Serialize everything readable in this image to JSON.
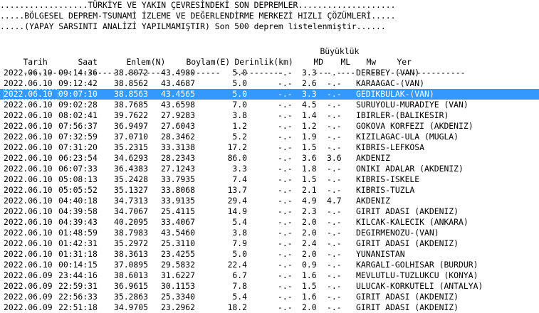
{
  "banner": [
    "..................TÜRKİYE VE YAKIN ÇEVRESİNDEKİ SON DEPREMLER....................",
    ".....BÖLGESEL DEPREM-TSUNAMİ İZLEME VE DEĞERLENDİRME MERKEZİ HIZLI ÇÖZÜMLERİ.....",
    ".....(YAPAY SARSINTI ANALİZİ YAPILMAMIŞTIR) Son 500 deprem listelenmiştir......"
  ],
  "columns": {
    "magnitude_group": "Büyüklük",
    "date": "Tarih",
    "time": "Saat",
    "lat": "Enlem(N)",
    "lon": "Boylam(E)",
    "depth": "Derinlik(km)",
    "md": "MD",
    "ml": "ML",
    "mw": "Mw",
    "place": "Yer"
  },
  "separators": {
    "date": "----------",
    "time": "--------",
    "lat": "--------",
    "lon": "-------",
    "depth": "----------",
    "md": "---",
    "ml": "---",
    "mw": "---",
    "place": "--------------"
  },
  "selected_index": 2,
  "rows": [
    {
      "date": "2022.06.10",
      "time": "09:14:36",
      "lat": "38.8072",
      "lon": "43.4980",
      "depth": "5.0",
      "md": "-.-",
      "ml": "3.3",
      "mw": "-.-",
      "place": "DEREBEY-(VAN)"
    },
    {
      "date": "2022.06.10",
      "time": "09:12:42",
      "lat": "38.8562",
      "lon": "43.4687",
      "depth": "5.0",
      "md": "-.-",
      "ml": "2.6",
      "mw": "-.-",
      "place": "KARAAGAC-(VAN)"
    },
    {
      "date": "2022.06.10",
      "time": "09:07:10",
      "lat": "38.8563",
      "lon": "43.4565",
      "depth": "5.0",
      "md": "-.-",
      "ml": "3.3",
      "mw": "-.-",
      "place": "GEDIKBULAK-(VAN)"
    },
    {
      "date": "2022.06.10",
      "time": "09:02:28",
      "lat": "38.7685",
      "lon": "43.6598",
      "depth": "7.0",
      "md": "-.-",
      "ml": "4.5",
      "mw": "-.-",
      "place": "SURUYOLU-MURADIYE (VAN)"
    },
    {
      "date": "2022.06.10",
      "time": "08:02:41",
      "lat": "39.7622",
      "lon": "27.9283",
      "depth": "3.8",
      "md": "-.-",
      "ml": "1.4",
      "mw": "-.-",
      "place": "IBIRLER-(BALIKESIR)"
    },
    {
      "date": "2022.06.10",
      "time": "07:56:37",
      "lat": "36.9497",
      "lon": "27.6043",
      "depth": "1.2",
      "md": "-.-",
      "ml": "1.2",
      "mw": "-.-",
      "place": "GOKOVA KORFEZI (AKDENIZ)"
    },
    {
      "date": "2022.06.10",
      "time": "07:32:59",
      "lat": "37.0710",
      "lon": "28.3462",
      "depth": "5.2",
      "md": "-.-",
      "ml": "1.9",
      "mw": "-.-",
      "place": "KIZILAGAC-ULA (MUGLA)"
    },
    {
      "date": "2022.06.10",
      "time": "07:31:20",
      "lat": "35.2315",
      "lon": "33.3138",
      "depth": "17.2",
      "md": "-.-",
      "ml": "1.5",
      "mw": "-.-",
      "place": "KIBRIS-LEFKOSA"
    },
    {
      "date": "2022.06.10",
      "time": "06:23:54",
      "lat": "34.6293",
      "lon": "28.2343",
      "depth": "86.0",
      "md": "-.-",
      "ml": "3.6",
      "mw": "3.6",
      "place": "AKDENIZ"
    },
    {
      "date": "2022.06.10",
      "time": "06:07:33",
      "lat": "36.4383",
      "lon": "27.1243",
      "depth": "3.3",
      "md": "-.-",
      "ml": "1.8",
      "mw": "-.-",
      "place": "ONIKI ADALAR (AKDENIZ)"
    },
    {
      "date": "2022.06.10",
      "time": "05:08:13",
      "lat": "35.2428",
      "lon": "33.7935",
      "depth": "7.4",
      "md": "-.-",
      "ml": "1.5",
      "mw": "-.-",
      "place": "KIBRIS-ISKELE"
    },
    {
      "date": "2022.06.10",
      "time": "05:05:52",
      "lat": "35.1327",
      "lon": "33.8068",
      "depth": "13.7",
      "md": "-.-",
      "ml": "2.1",
      "mw": "-.-",
      "place": "KIBRIS-TUZLA"
    },
    {
      "date": "2022.06.10",
      "time": "04:40:18",
      "lat": "34.7313",
      "lon": "33.9135",
      "depth": "29.4",
      "md": "-.-",
      "ml": "4.9",
      "mw": "4.7",
      "place": "AKDENIZ"
    },
    {
      "date": "2022.06.10",
      "time": "04:39:58",
      "lat": "34.7067",
      "lon": "25.4115",
      "depth": "14.9",
      "md": "-.-",
      "ml": "2.3",
      "mw": "-.-",
      "place": "GIRIT ADASI (AKDENIZ)"
    },
    {
      "date": "2022.06.10",
      "time": "04:39:43",
      "lat": "40.2095",
      "lon": "33.4067",
      "depth": "5.4",
      "md": "-.-",
      "ml": "2.0",
      "mw": "-.-",
      "place": "KILCAK-KALECIK (ANKARA)"
    },
    {
      "date": "2022.06.10",
      "time": "01:48:59",
      "lat": "38.7983",
      "lon": "43.5460",
      "depth": "3.8",
      "md": "-.-",
      "ml": "2.0",
      "mw": "-.-",
      "place": "DEGIRMENOZU-(VAN)"
    },
    {
      "date": "2022.06.10",
      "time": "01:42:31",
      "lat": "35.2972",
      "lon": "25.3110",
      "depth": "7.9",
      "md": "-.-",
      "ml": "2.4",
      "mw": "-.-",
      "place": "GIRIT ADASI (AKDENIZ)"
    },
    {
      "date": "2022.06.10",
      "time": "01:31:18",
      "lat": "38.3613",
      "lon": "23.4255",
      "depth": "5.0",
      "md": "-.-",
      "ml": "2.0",
      "mw": "-.-",
      "place": "YUNANISTAN"
    },
    {
      "date": "2022.06.10",
      "time": "00:14:15",
      "lat": "37.0895",
      "lon": "29.5832",
      "depth": "22.4",
      "md": "-.-",
      "ml": "0.9",
      "mw": "-.-",
      "place": "KARGALI-GOLHISAR (BURDUR)"
    },
    {
      "date": "2022.06.09",
      "time": "23:44:16",
      "lat": "38.6013",
      "lon": "31.6227",
      "depth": "6.7",
      "md": "-.-",
      "ml": "1.6",
      "mw": "-.-",
      "place": "MEVLUTLU-TUZLUKCU (KONYA)"
    },
    {
      "date": "2022.06.09",
      "time": "22:59:31",
      "lat": "36.9615",
      "lon": "30.1153",
      "depth": "7.8",
      "md": "-.-",
      "ml": "1.5",
      "mw": "-.-",
      "place": "ULUCAK-KORKUTELI (ANTALYA)"
    },
    {
      "date": "2022.06.09",
      "time": "22:56:33",
      "lat": "35.2863",
      "lon": "25.3340",
      "depth": "5.4",
      "md": "-.-",
      "ml": "1.6",
      "mw": "-.-",
      "place": "GIRIT ADASI (AKDENIZ)"
    },
    {
      "date": "2022.06.09",
      "time": "22:51:18",
      "lat": "34.9705",
      "lon": "23.2962",
      "depth": "18.2",
      "md": "-.-",
      "ml": "2.0",
      "mw": "-.-",
      "place": "GIRIT ADASI (AKDENIZ)"
    }
  ]
}
